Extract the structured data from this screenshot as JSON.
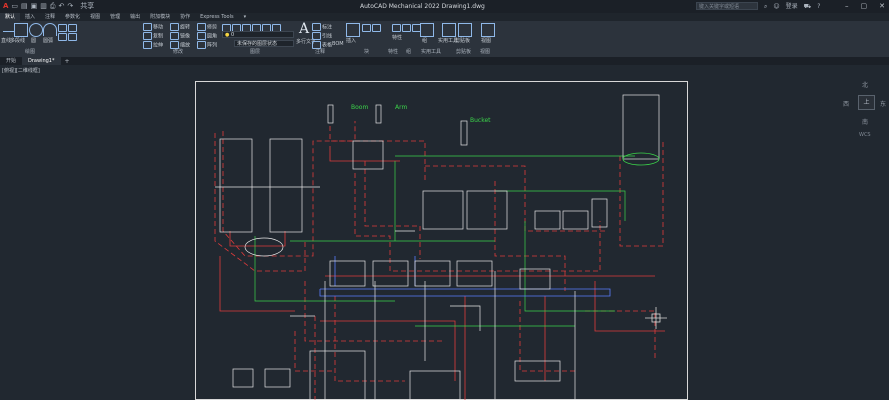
{
  "quick_access": {
    "share_label": "共享"
  },
  "window": {
    "title": "AutoCAD Mechanical 2022   Drawing1.dwg"
  },
  "search": {
    "placeholder": "键入关键字或短语"
  },
  "account": {
    "login": "登录"
  },
  "ribbon_tabs": [
    "默认",
    "插入",
    "注释",
    "参数化",
    "视图",
    "管理",
    "输出",
    "附加模块",
    "协作",
    "Express Tools"
  ],
  "ribbon": {
    "draw_tools": [
      "直线",
      "多段线",
      "圆",
      "圆弧"
    ],
    "modify_tools": [
      "移动",
      "旋转",
      "修剪",
      "复制",
      "镜像",
      "圆角",
      "拉伸",
      "缩放",
      "阵列"
    ],
    "layer_current": "0",
    "layer_state": "未保存的图层状态",
    "text_label": "多行文字",
    "annot_tools": [
      "标注",
      "引线",
      "表格",
      "BOM"
    ],
    "block_label": "插入",
    "properties_label": "特性",
    "groups_label": "组",
    "utilities_label": "实用工具",
    "clipboard_label": "剪贴板",
    "view_label": "视图"
  },
  "panel_labels": [
    "绘图",
    "修改",
    "图层",
    "注释",
    "块",
    "特性",
    "组",
    "实用工具",
    "剪贴板",
    "视图"
  ],
  "document_tabs": [
    {
      "label": "开始",
      "active": false
    },
    {
      "label": "Drawing1*",
      "active": true
    }
  ],
  "viewport": {
    "label": "[俯视][二维线框]"
  },
  "viewcube": {
    "north": "北",
    "west": "西",
    "east": "东",
    "south": "南",
    "center": "上",
    "wcs": "WCS"
  },
  "drawing_labels": {
    "boom": "Boom",
    "arm": "Arm",
    "bucket": "Bucket"
  },
  "colors": {
    "accent": "#8fb8e8",
    "line_red": "#e03b3b",
    "line_green": "#3bd44a",
    "line_blue": "#5a7dff",
    "line_white": "#e6e6e6"
  }
}
